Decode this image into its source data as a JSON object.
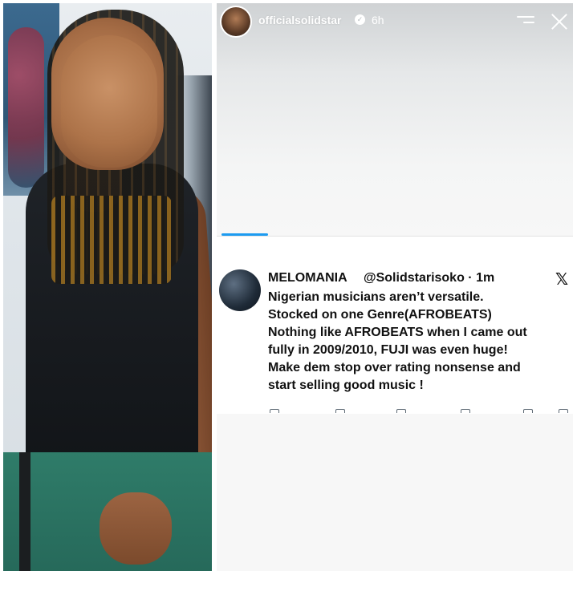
{
  "story": {
    "username": "officialsolidstar",
    "time": "6h",
    "verified_glyph": "✓",
    "accent_color": "#1d9bf0"
  },
  "tweet": {
    "display_name": "MELOMANIA",
    "handle_time": "@Solidstarisoko · 1m",
    "x_glyph": "𝕏",
    "lines": [
      "Nigerian musicians aren’t versatile.",
      "Stocked on one Genre(AFROBEATS)",
      "Nothing like AFROBEATS when I came out",
      "fully in 2009/2010, FUJI was even huge!",
      "Make dem stop over rating nonsense and",
      "start selling good music !"
    ]
  },
  "icons": [
    "verified-icon",
    "menu-icon",
    "close-icon",
    "x-logo-icon"
  ]
}
